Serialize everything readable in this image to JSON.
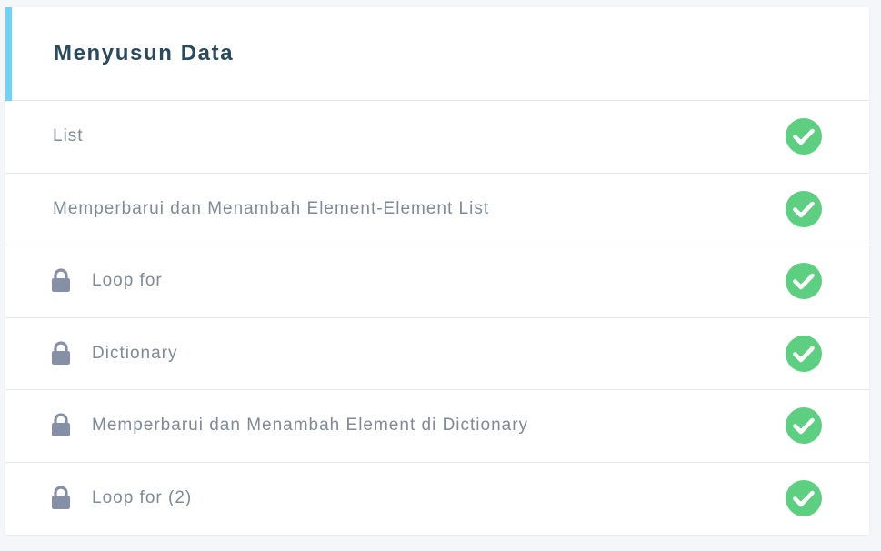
{
  "colors": {
    "accent": "#6fd3f5",
    "title": "#2a4a5e",
    "label": "#7f8a96",
    "lock": "#8590a6",
    "check_circle": "#5ccf80"
  },
  "section": {
    "title": "Menyusun Data",
    "lessons": [
      {
        "label": "List",
        "locked": false,
        "completed": true,
        "status_icon": "check-circle-icon"
      },
      {
        "label": "Memperbarui dan Menambah Element-Element List",
        "locked": false,
        "completed": true,
        "status_icon": "check-circle-icon"
      },
      {
        "label": "Loop for",
        "locked": true,
        "completed": true,
        "lock_icon": "lock-icon",
        "status_icon": "check-circle-icon"
      },
      {
        "label": "Dictionary",
        "locked": true,
        "completed": true,
        "lock_icon": "lock-icon",
        "status_icon": "check-circle-icon"
      },
      {
        "label": "Memperbarui dan Menambah Element di Dictionary",
        "locked": true,
        "completed": true,
        "lock_icon": "lock-icon",
        "status_icon": "check-circle-icon"
      },
      {
        "label": "Loop for (2)",
        "locked": true,
        "completed": true,
        "lock_icon": "lock-icon",
        "status_icon": "check-circle-icon"
      }
    ]
  }
}
